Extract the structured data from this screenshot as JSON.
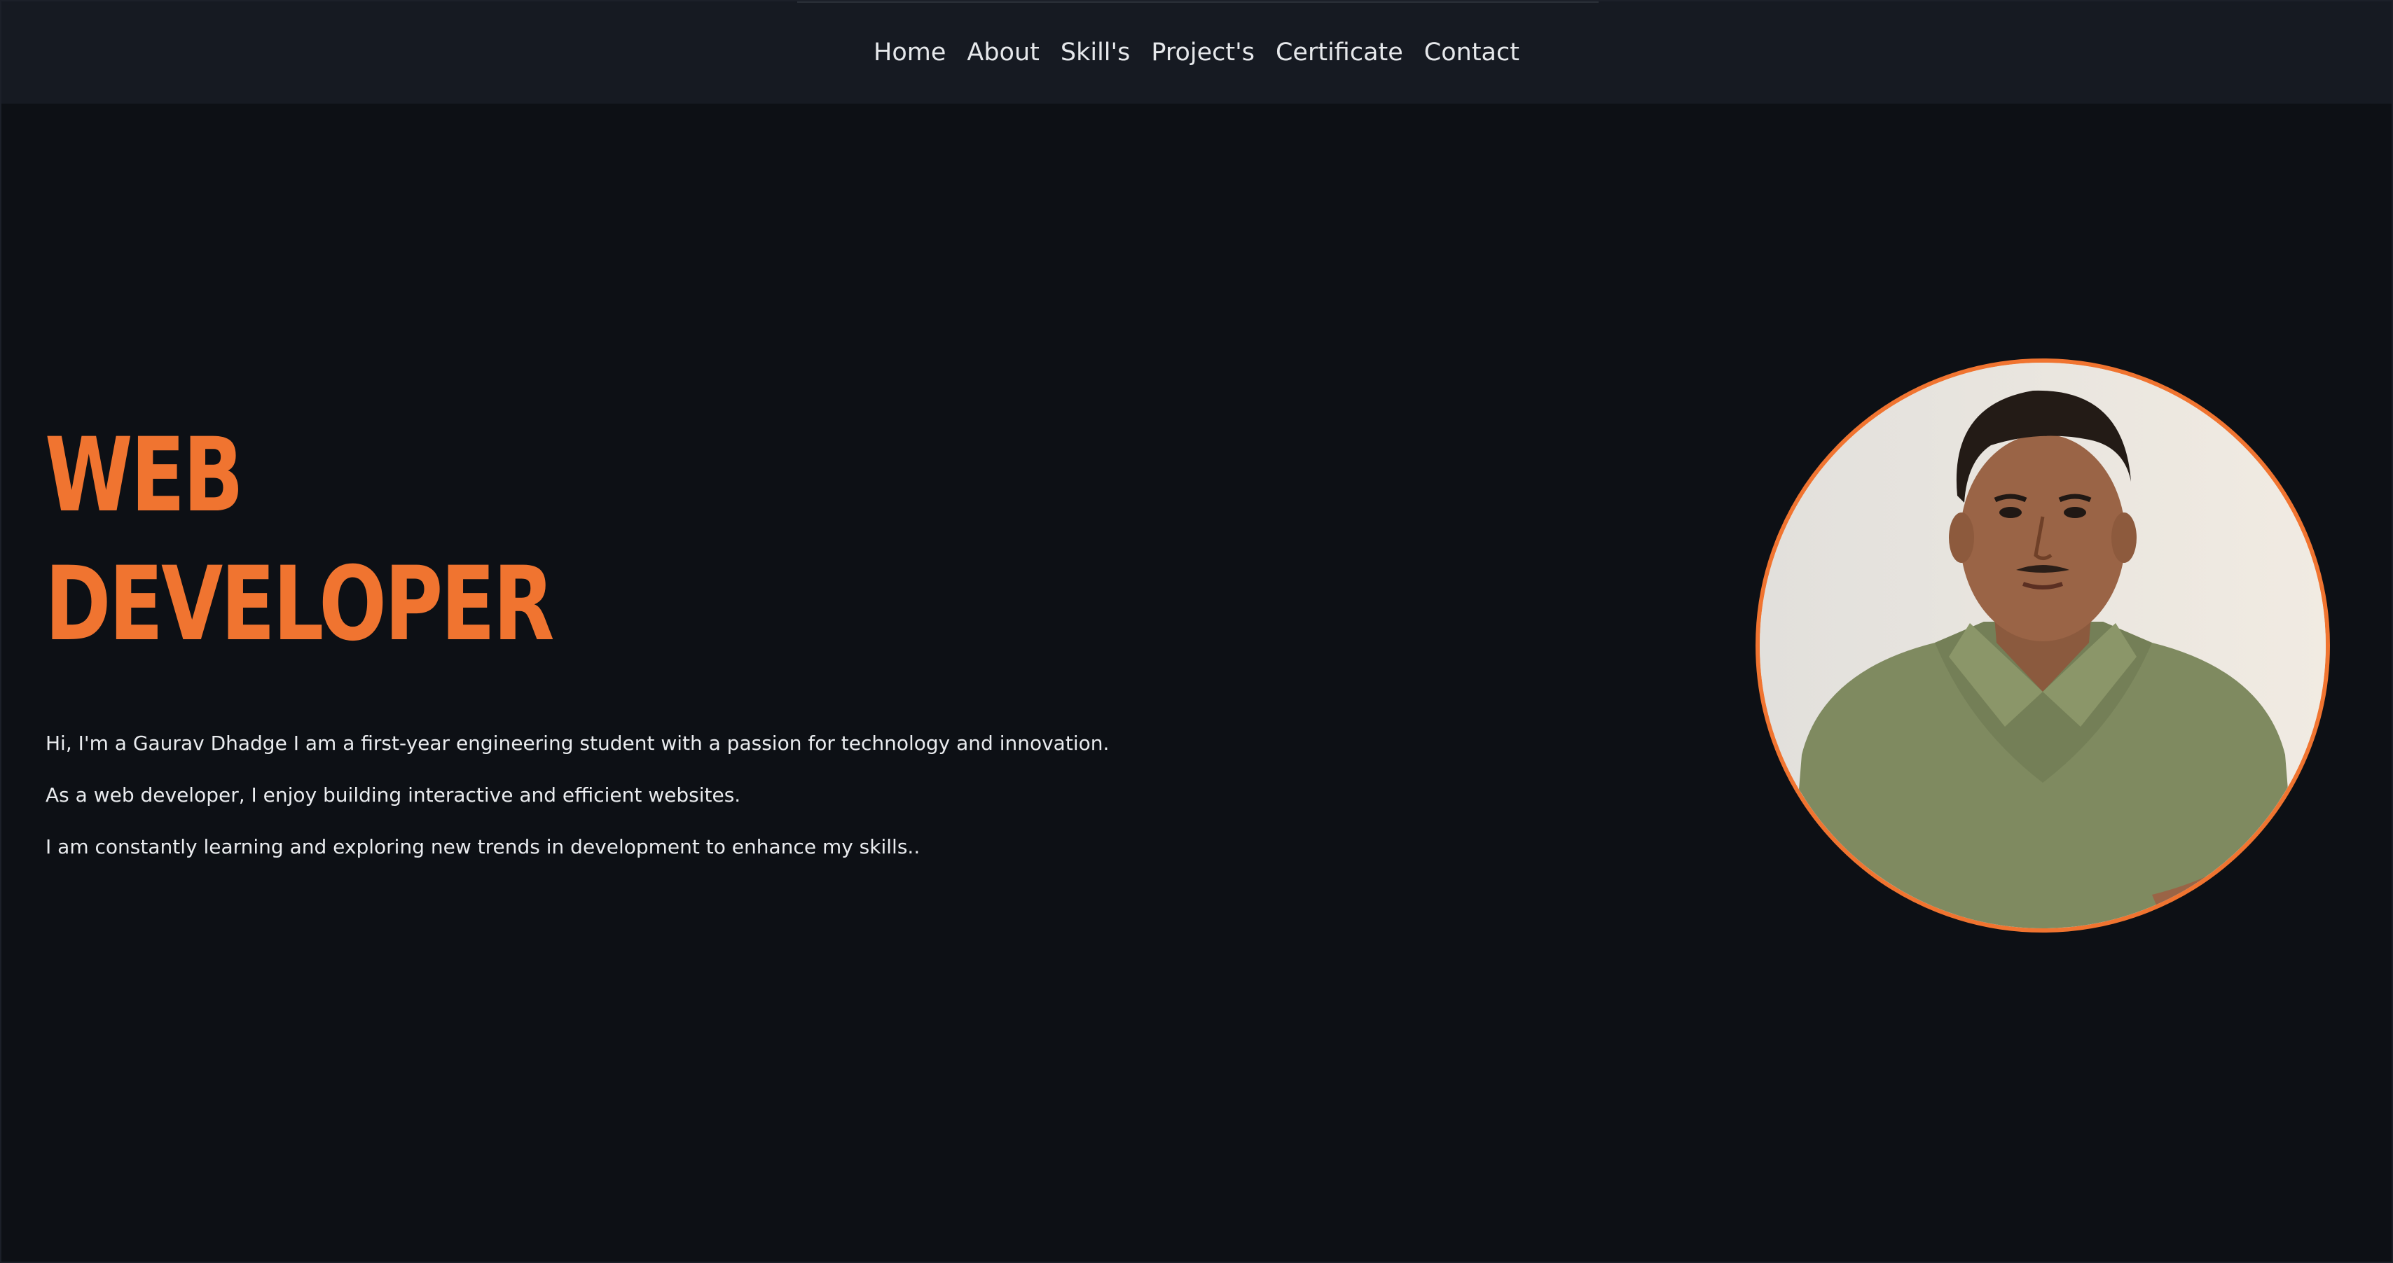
{
  "nav": {
    "items": [
      "Home",
      "About",
      "Skill's",
      "Project's",
      "Certificate",
      "Contact"
    ]
  },
  "hero": {
    "title_line1": "WEB",
    "title_line2": "DEVELOPER",
    "paragraphs": [
      "Hi, I'm a Gaurav Dhadge I am a first-year engineering student with a passion for technology and innovation.",
      "As a web developer, I enjoy building interactive and efficient websites.",
      "I am constantly learning and exploring new trends in development to enhance my skills.."
    ]
  },
  "colors": {
    "accent": "#f07430",
    "background": "#0d1015",
    "navbar": "#161a22",
    "text": "#e9ebee"
  }
}
